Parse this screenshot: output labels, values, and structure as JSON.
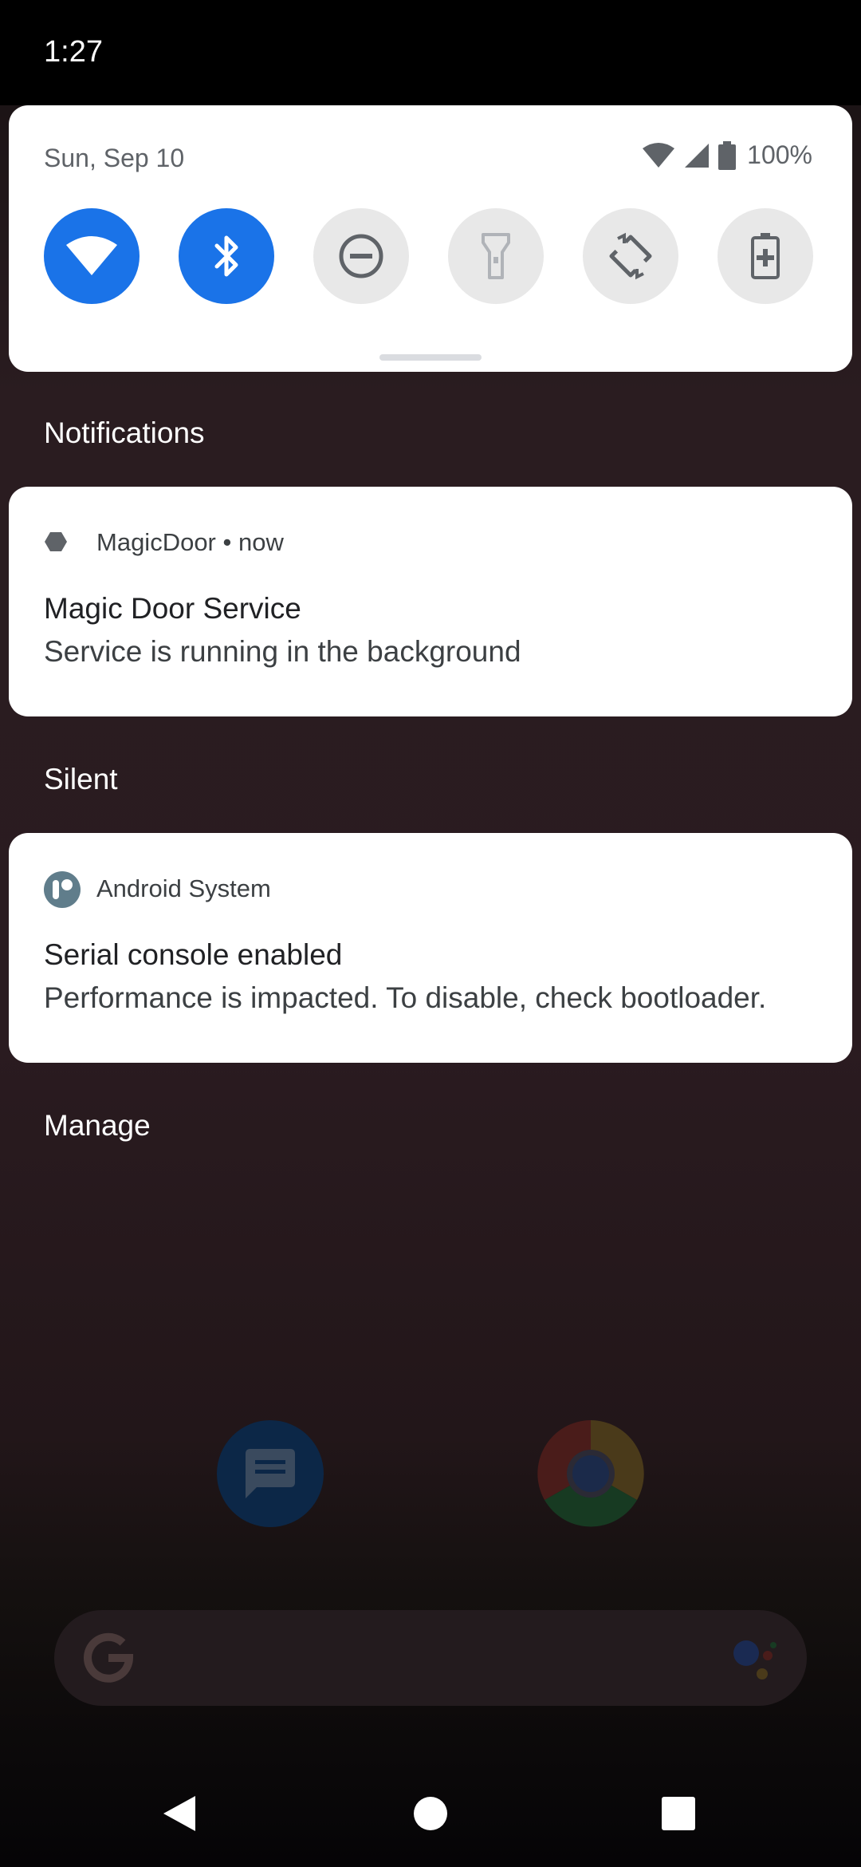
{
  "status_bar": {
    "time": "1:27"
  },
  "quick_settings": {
    "date": "Sun, Sep 10",
    "battery": "100%",
    "tiles": [
      {
        "name": "wifi",
        "icon": "wifi-icon",
        "state": "on"
      },
      {
        "name": "bluetooth",
        "icon": "bluetooth-icon",
        "state": "on"
      },
      {
        "name": "do-not-disturb",
        "icon": "do-not-disturb-icon",
        "state": "off"
      },
      {
        "name": "flashlight",
        "icon": "flashlight-icon",
        "state": "off"
      },
      {
        "name": "auto-rotate",
        "icon": "auto-rotate-icon",
        "state": "off"
      },
      {
        "name": "battery-saver",
        "icon": "battery-saver-icon",
        "state": "off"
      }
    ],
    "accent_color": "#1a73e8"
  },
  "notifications": {
    "header": "Notifications",
    "items": [
      {
        "app": "MagicDoor",
        "time": "now",
        "title": "Magic Door Service",
        "text": "Service is running in the background"
      }
    ]
  },
  "silent": {
    "header": "Silent",
    "items": [
      {
        "app": "Android System",
        "title": "Serial console enabled",
        "text": "Performance is impacted. To disable, check bootloader."
      }
    ]
  },
  "manage_label": "Manage",
  "home_screen": {
    "apps": [
      {
        "name": "messages",
        "icon": "messages-icon"
      },
      {
        "name": "chrome",
        "icon": "chrome-icon"
      }
    ],
    "search_icons": [
      "google-logo-icon",
      "assistant-icon"
    ]
  },
  "nav_bar": {
    "buttons": [
      "back-icon",
      "home-icon",
      "recents-icon"
    ]
  }
}
